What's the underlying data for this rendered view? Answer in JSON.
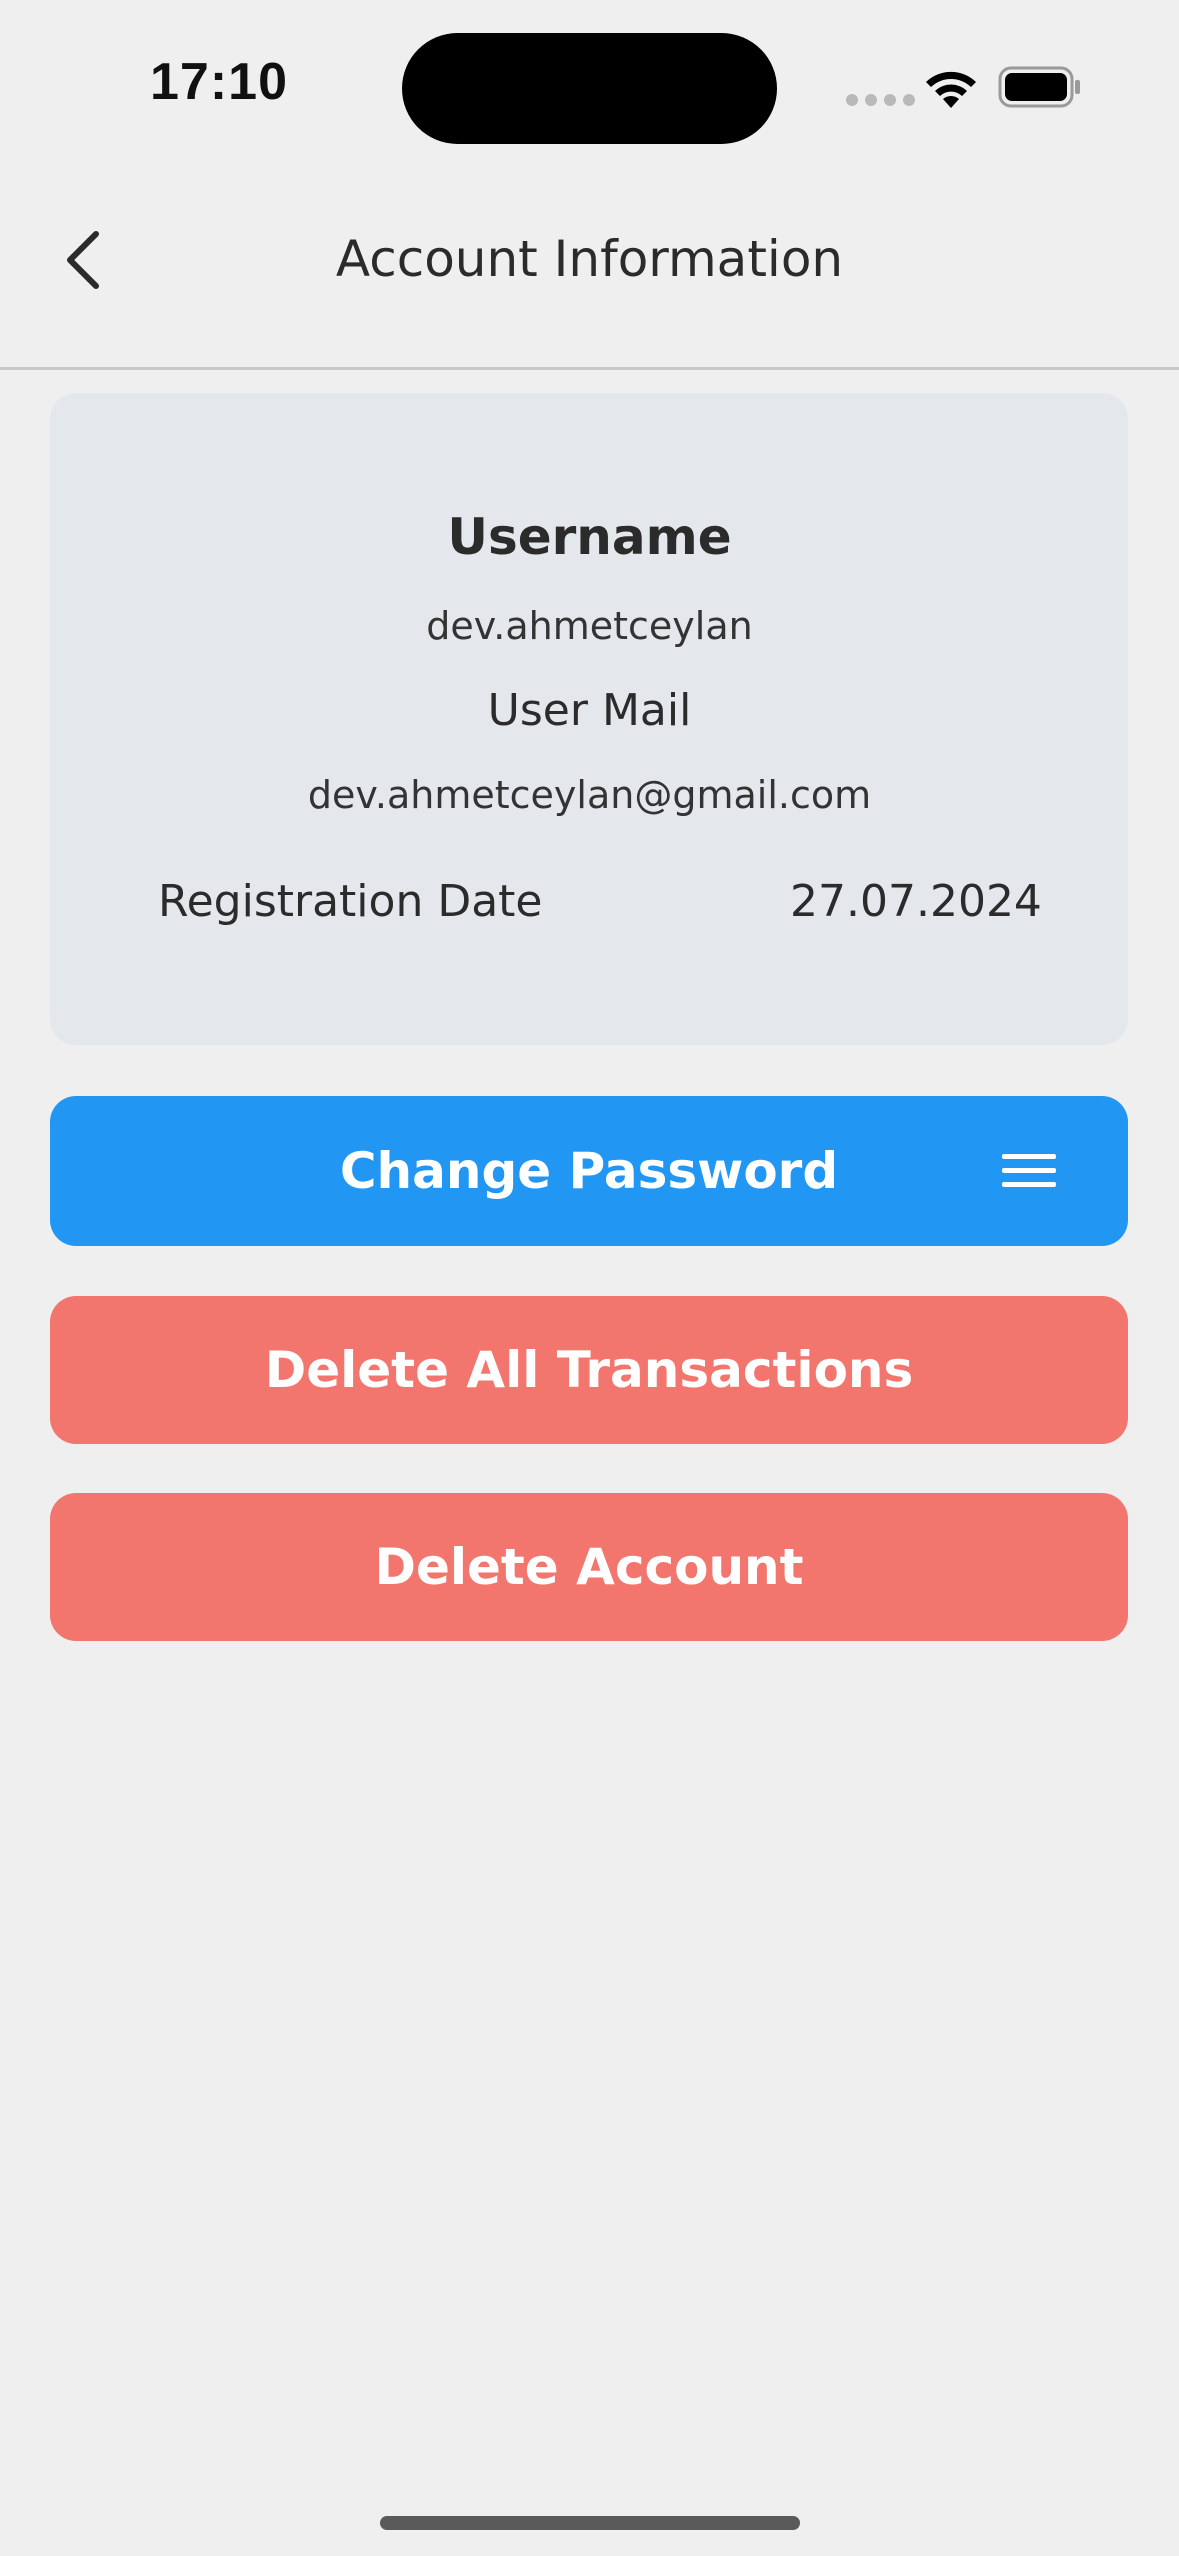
{
  "status_bar": {
    "time": "17:10"
  },
  "header": {
    "title": "Account Information"
  },
  "account": {
    "username_label": "Username",
    "username_value": "dev.ahmetceylan",
    "mail_label": "User Mail",
    "mail_value": "dev.ahmetceylan@gmail.com",
    "registration_label": "Registration Date",
    "registration_value": "27.07.2024"
  },
  "actions": {
    "change_password": "Change Password",
    "delete_transactions": "Delete All Transactions",
    "delete_account": "Delete Account"
  },
  "colors": {
    "primary": "#2196f3",
    "danger": "#f3766e",
    "card_background": "#e4e7eb",
    "page_background": "#efefef"
  },
  "icons": {
    "back": "chevron-left-icon",
    "menu": "menu-icon",
    "wifi": "wifi-icon",
    "battery": "battery-icon"
  }
}
